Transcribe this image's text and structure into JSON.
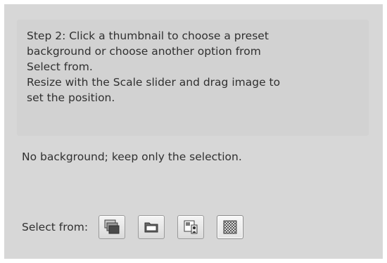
{
  "instructions": {
    "text": "Step 2: Click a thumbnail to choose a preset\nbackground or choose another option from\nSelect from.\nResize with the Scale slider and drag image to\nset the position."
  },
  "status": {
    "text": "No background; keep only the selection."
  },
  "select_from": {
    "label": "Select from:",
    "options": [
      {
        "icon": "stacked-layers-icon",
        "selected": false
      },
      {
        "icon": "folder-icon",
        "selected": false
      },
      {
        "icon": "image-person-icon",
        "selected": false
      },
      {
        "icon": "transparency-checker-icon",
        "selected": true
      }
    ]
  }
}
